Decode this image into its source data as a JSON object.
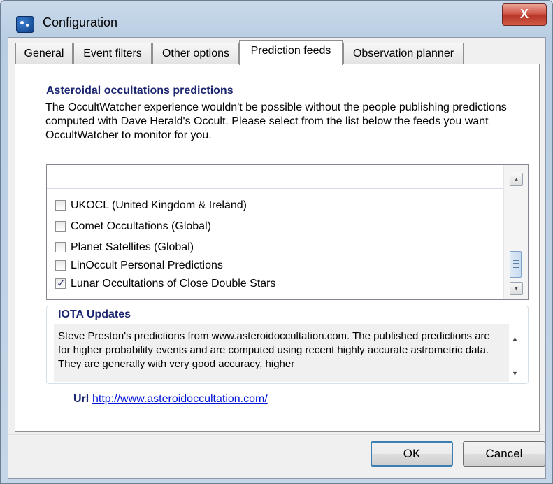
{
  "window": {
    "title": "Configuration",
    "close_label": "X"
  },
  "tabs": [
    {
      "label": "General",
      "active": false
    },
    {
      "label": "Event filters",
      "active": false
    },
    {
      "label": "Other options",
      "active": false
    },
    {
      "label": "Prediction feeds",
      "active": true
    },
    {
      "label": "Observation planner",
      "active": false
    }
  ],
  "section": {
    "heading": "Asteroidal occultations predictions",
    "description": "The OccultWatcher experience wouldn't be possible without the people publishing predictions computed with Dave Herald's Occult. Please select from the list below the feeds you want OccultWatcher to monitor for you."
  },
  "feeds": [
    {
      "label": "UKOCL (United Kingdom & Ireland)",
      "checked": false
    },
    {
      "label": "Comet Occultations (Global)",
      "checked": false
    },
    {
      "label": "Planet Satellites (Global)",
      "checked": false
    },
    {
      "label": "LinOccult Personal Predictions",
      "checked": false
    },
    {
      "label": "Lunar Occultations of Close Double Stars",
      "checked": true
    }
  ],
  "details": {
    "title": "IOTA Updates",
    "text": "Steve Preston's predictions from www.asteroidoccultation.com. The published predictions are for higher probability events and are computed using recent highly accurate astrometric data. They are generally with very good accuracy, higher",
    "url_label": "Url",
    "url": "http://www.asteroidoccultation.com/"
  },
  "buttons": {
    "ok": "OK",
    "cancel": "Cancel"
  },
  "icons": {
    "scroll_up": "scroll-up-icon",
    "scroll_down": "scroll-down-icon",
    "app": "occultwatcher-app-icon"
  }
}
